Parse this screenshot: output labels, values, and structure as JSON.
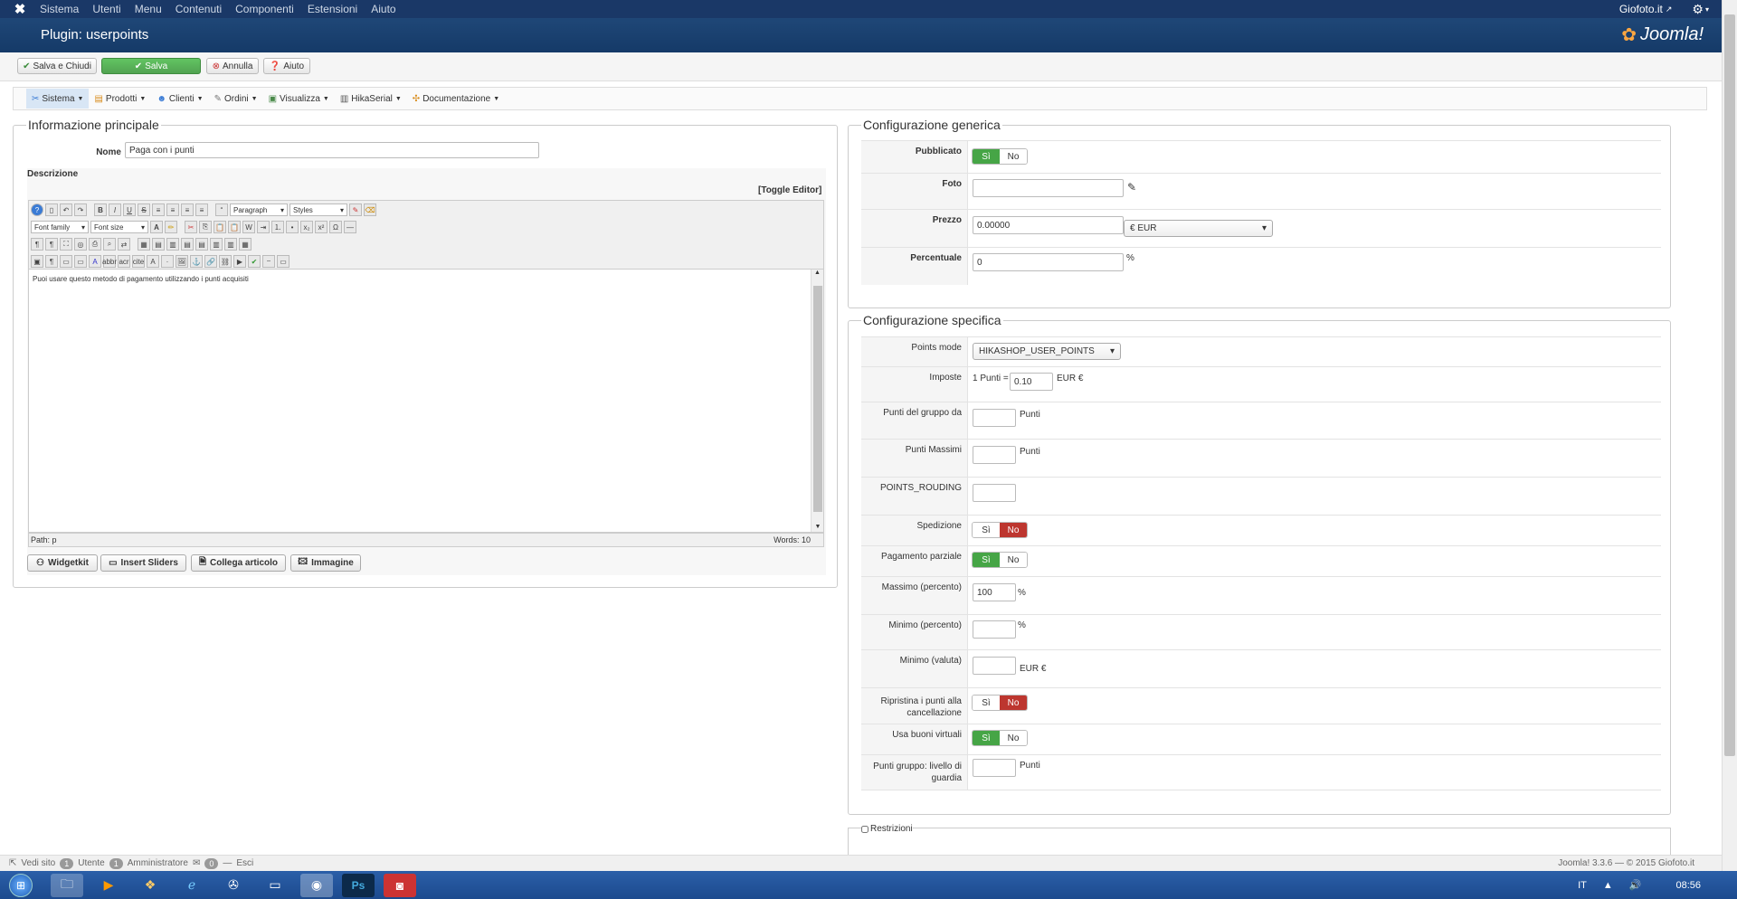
{
  "topnav": {
    "menu": [
      "Sistema",
      "Utenti",
      "Menu",
      "Contenuti",
      "Componenti",
      "Estensioni",
      "Aiuto"
    ],
    "site_name": "Giofoto.it"
  },
  "header": {
    "title": "Plugin: userpoints",
    "brand": "Joomla!"
  },
  "toolbar": {
    "save_close": "Salva e Chiudi",
    "save": "Salva",
    "cancel": "Annulla",
    "help": "Aiuto"
  },
  "submenu": [
    "Sistema",
    "Prodotti",
    "Clienti",
    "Ordini",
    "Visualizza",
    "HikaSerial",
    "Documentazione"
  ],
  "main_info": {
    "legend": "Informazione principale",
    "name_label": "Nome",
    "name_value": "Paga con i punti",
    "desc_label": "Descrizione",
    "toggle_editor": "[Toggle Editor]",
    "format_select": "Paragraph",
    "styles_select": "Styles",
    "font_family": "Font family",
    "font_size": "Font size",
    "content": "Puoi usare questo metodo di pagamento utilizzando i punti acquisiti",
    "path": "Path: p",
    "words": "Words: 10",
    "buttons": [
      "Widgetkit",
      "Insert Sliders",
      "Collega articolo",
      "Immagine"
    ]
  },
  "generic": {
    "legend": "Configurazione generica",
    "published": "Pubblicato",
    "yes": "Sì",
    "no": "No",
    "photo": "Foto",
    "price": "Prezzo",
    "price_value": "0.00000",
    "currency": "€ EUR",
    "percent": "Percentuale",
    "percent_value": "0",
    "percent_unit": "%"
  },
  "specific": {
    "legend": "Configurazione specifica",
    "points_mode": "Points mode",
    "points_mode_value": "HIKASHOP_USER_POINTS",
    "tax": "Imposte",
    "tax_prefix": "1 Punti =",
    "tax_value": "0.10",
    "tax_unit": "EUR €",
    "group_points": "Punti del gruppo da",
    "points_unit": "Punti",
    "max_points": "Punti Massimi",
    "rounding": "POINTS_ROUDING",
    "shipping": "Spedizione",
    "partial": "Pagamento parziale",
    "max_percent": "Massimo (percento)",
    "max_percent_value": "100",
    "min_percent": "Minimo (percento)",
    "min_currency": "Minimo (valuta)",
    "currency_unit": "EUR €",
    "restore_line1": "Ripristina i punti alla",
    "restore_line2": "cancellazione",
    "virtual": "Usa buoni virtuali",
    "guard_line1": "Punti gruppo: livello di",
    "guard_line2": "guardia",
    "percent_unit": "%"
  },
  "restrictions": {
    "label": "Restrizioni"
  },
  "status": {
    "view_site": "Vedi sito",
    "users_count": "1",
    "users": "Utente",
    "admins_count": "1",
    "admins": "Amministratore",
    "msgs_count": "0",
    "logout": "Esci",
    "version": "Joomla! 3.3.6 — © 2015 Giofoto.it"
  },
  "taskbar": {
    "lang": "IT",
    "time": "08:56"
  }
}
